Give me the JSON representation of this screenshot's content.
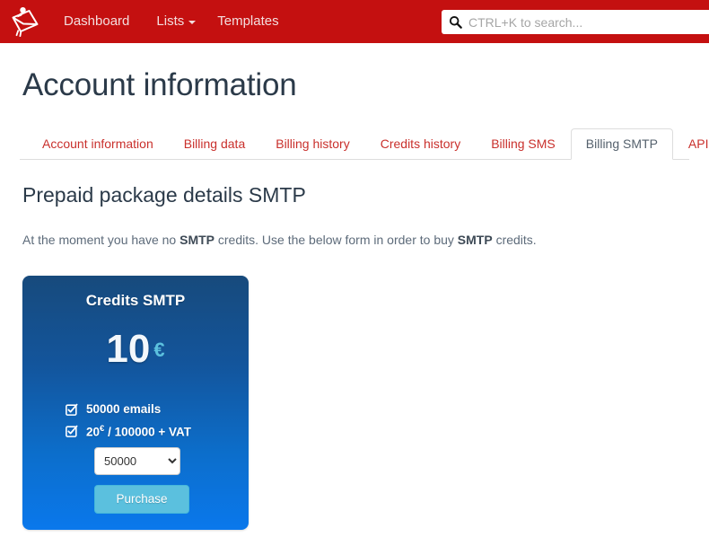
{
  "navbar": {
    "brand_icon": "envelope-logo-icon",
    "brand_color": "#c41010",
    "items": [
      {
        "label": "Dashboard",
        "caret": false
      },
      {
        "label": "Lists",
        "caret": true
      },
      {
        "label": "Templates",
        "caret": false
      }
    ],
    "search": {
      "icon": "search-icon",
      "placeholder": "CTRL+K to search...",
      "value": ""
    }
  },
  "page": {
    "title": "Account information"
  },
  "tabs": [
    {
      "label": "Account information",
      "active": false
    },
    {
      "label": "Billing data",
      "active": false
    },
    {
      "label": "Billing history",
      "active": false
    },
    {
      "label": "Credits history",
      "active": false
    },
    {
      "label": "Billing SMS",
      "active": false
    },
    {
      "label": "Billing SMTP",
      "active": true
    },
    {
      "label": "API",
      "active": false
    }
  ],
  "content": {
    "section_title": "Prepaid package details SMTP",
    "intro": {
      "part1": "At the moment you have no ",
      "bold1": "SMTP",
      "part2": " credits. Use the below form in order to buy ",
      "bold2": "SMTP",
      "part3": " credits."
    },
    "card": {
      "title": "Credits SMTP",
      "price_amount": "10",
      "price_currency": "€",
      "accent_color": "#5bc0de",
      "gradient_top": "#174a7c",
      "gradient_bottom": "#0a78ec",
      "features": [
        {
          "icon": "check-square-icon",
          "text": "50000 emails",
          "sup": ""
        },
        {
          "icon": "check-square-icon",
          "text_before": "20",
          "sup": "€",
          "text_after": " / 100000 + VAT"
        }
      ],
      "quantity": {
        "selected": "50000",
        "options": [
          "50000"
        ]
      },
      "purchase_label": "Purchase"
    }
  }
}
